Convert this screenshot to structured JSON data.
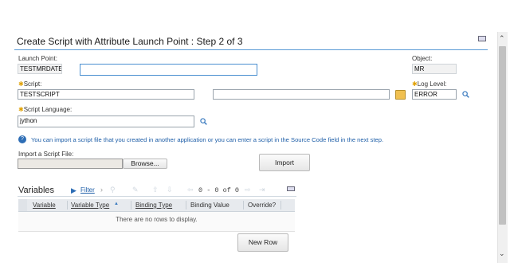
{
  "dialog": {
    "title": "Create Script with Attribute Launch Point : Step 2 of 3",
    "minimize_icon": "minimize-icon"
  },
  "form": {
    "launch_point": {
      "label": "Launch Point:",
      "value": "TESTMRDATE",
      "description": ""
    },
    "object": {
      "label": "Object:",
      "value": "MR"
    },
    "script": {
      "label": "Script:",
      "value": "TESTSCRIPT",
      "description": ""
    },
    "log_level": {
      "label": "Log Level:",
      "value": "ERROR"
    },
    "script_language": {
      "label": "Script Language:",
      "value": "jython"
    },
    "info_text": "You can import a script file that you created in another application or you can enter a script in the Source Code field in the next step.",
    "import_file": {
      "label": "Import a Script File:",
      "browse_label": "Browse...",
      "value": ""
    },
    "import_button": "Import"
  },
  "variables": {
    "title": "Variables",
    "filter_label": "Filter",
    "pagination": "0 - 0 of 0",
    "columns": [
      "Variable",
      "Variable Type",
      "Binding Type",
      "Binding Value",
      "Override?"
    ],
    "empty_message": "There are no rows to display.",
    "new_row_button": "New Row"
  },
  "colors": {
    "accent": "#5b9bd5",
    "link": "#1f5fa8",
    "required": "#e0a000"
  }
}
